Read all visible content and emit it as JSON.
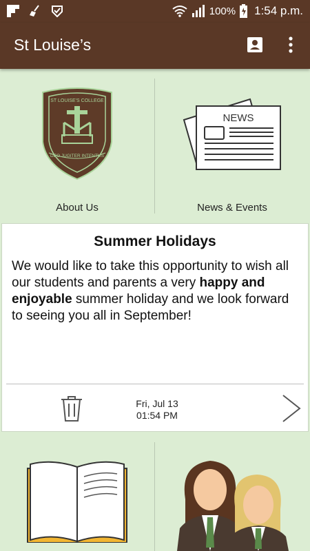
{
  "status": {
    "battery": "100%",
    "time": "1:54 p.m."
  },
  "app_bar": {
    "title": "St Louise’s",
    "contact_icon": "contact-card-icon",
    "menu_icon": "more-vert-icon"
  },
  "tiles_top": [
    {
      "label": "About Us",
      "icon": "school-crest-icon"
    },
    {
      "label": "News & Events",
      "icon": "newspaper-icon"
    }
  ],
  "crest": {
    "ring_text": "ST LOUISE'S COLLEGE",
    "motto": "DEO JUGITER INTENTUS"
  },
  "newspaper": {
    "masthead": "NEWS"
  },
  "notice": {
    "title": "Summer Holidays",
    "body_part1": "We would like to take this opportunity to wish all our students and parents a very ",
    "body_bold": "happy and enjoyable",
    "body_part2": " summer holiday and we look forward to seeing you all in September!",
    "date": "Fri, Jul 13",
    "time": "01:54 PM"
  },
  "tiles_bottom": [
    {
      "icon": "open-book-icon"
    },
    {
      "icon": "students-icon"
    }
  ],
  "colors": {
    "app_bar": "#5a3826",
    "background": "#dcedd3",
    "crest": "#5e3b28",
    "crest_accent": "#a9d49a"
  }
}
